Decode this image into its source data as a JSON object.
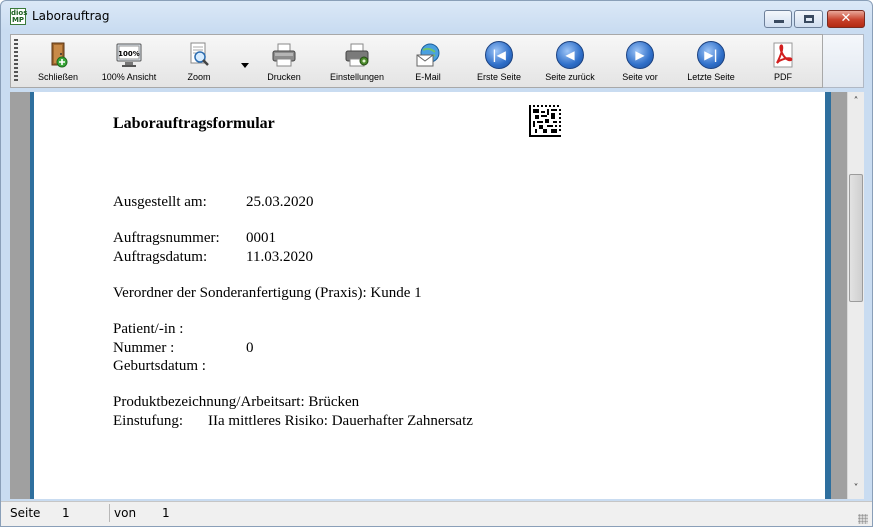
{
  "window": {
    "title": "Laborauftrag",
    "app_icon_text": [
      "dios",
      "MP"
    ]
  },
  "toolbar": {
    "buttons": [
      {
        "label": "Schließen",
        "icon": "door-exit-icon"
      },
      {
        "label": "100% Ansicht",
        "icon": "monitor-100-icon"
      },
      {
        "label": "Zoom",
        "icon": "zoom-magnifier-icon"
      },
      {
        "label": "Drucken",
        "icon": "printer-icon"
      },
      {
        "label": "Einstellungen",
        "icon": "printer-settings-icon"
      },
      {
        "label": "E-Mail",
        "icon": "email-icon"
      },
      {
        "label": "Erste Seite",
        "icon": "first-page-icon"
      },
      {
        "label": "Seite zurück",
        "icon": "previous-page-icon"
      },
      {
        "label": "Seite vor",
        "icon": "next-page-icon"
      },
      {
        "label": "Letzte Seite",
        "icon": "last-page-icon"
      },
      {
        "label": "PDF",
        "icon": "pdf-icon"
      }
    ]
  },
  "document": {
    "title": "Laborauftragsformular",
    "issued_label": "Ausgestellt am:",
    "issued_value": "25.03.2020",
    "order_number_label": "Auftragsnummer:",
    "order_number_value": "0001",
    "order_date_label": "Auftragsdatum:",
    "order_date_value": "11.03.2020",
    "prescriber": "Verordner der Sonderanfertigung (Praxis): Kunde 1",
    "patient_label": "Patient/-in :",
    "number_label": "Nummer :",
    "number_value": "0",
    "birthdate_label": "Geburtsdatum :",
    "product": "Produktbezeichnung/Arbeitsart: Brücken",
    "classification_label": "Einstufung:",
    "classification_value": "IIa mittleres Risiko: Dauerhafter Zahnersatz"
  },
  "status": {
    "page_label": "Seite",
    "page_value": "1",
    "of_label": "von",
    "of_value": "1"
  },
  "colors": {
    "title_gradient_top": "#dbe8f7",
    "page_border": "#2e6f9e",
    "background_gray": "#a0a0a0",
    "close_button": "#c8412b",
    "pdf_red": "#d21f1f"
  }
}
